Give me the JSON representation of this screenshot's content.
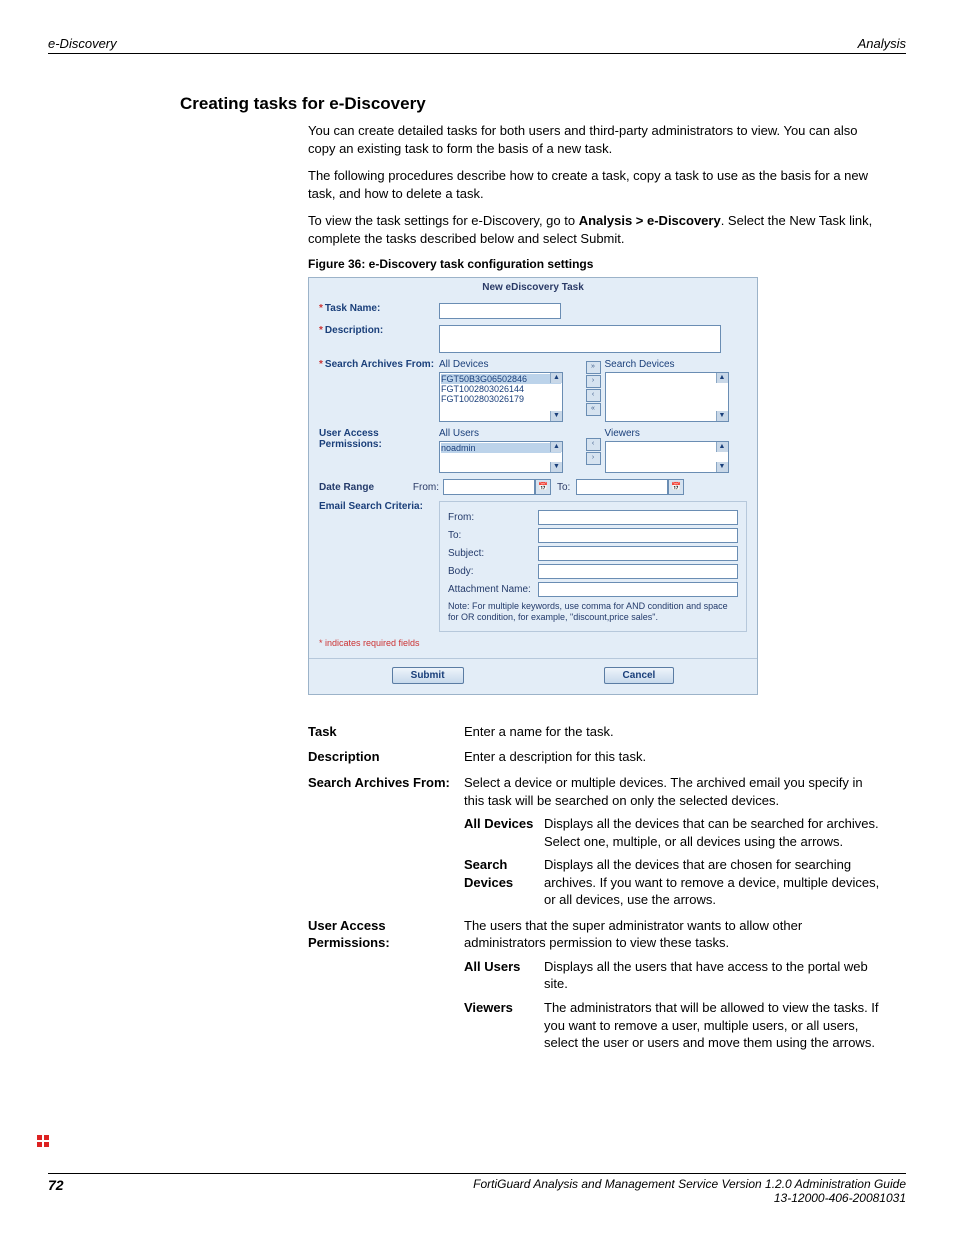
{
  "header": {
    "left": "e-Discovery",
    "right": "Analysis"
  },
  "h2": "Creating tasks for e-Discovery",
  "p1": "You can create detailed tasks for both users and third-party administrators to view. You can also copy an existing task to form the basis of a new task.",
  "p2": "The following procedures describe how to create a task, copy a task to use as the basis for a new task, and how to delete a task.",
  "p3a": "To view the task settings for e-Discovery, go to ",
  "p3b": "Analysis > e-Discovery",
  "p3c": ". Select the New Task link, complete the tasks described below and select Submit.",
  "figcap": "Figure 36: e-Discovery task configuration settings",
  "shot": {
    "title": "New eDiscovery Task",
    "labels": {
      "task_name": "Task Name:",
      "description": "Description:",
      "search_from": "Search Archives From:",
      "all_devices": "All Devices",
      "search_devices": "Search Devices",
      "uap": "User Access Permissions:",
      "all_users": "All Users",
      "viewers": "Viewers",
      "date_range": "Date Range",
      "from": "From:",
      "to": "To:",
      "criteria": "Email Search Criteria:",
      "c_from": "From:",
      "c_to": "To:",
      "c_subject": "Subject:",
      "c_body": "Body:",
      "c_attach": "Attachment Name:",
      "note": "Note: For multiple keywords, use comma for AND condition and space for OR condition, for example, \"discount,price sales\".",
      "req": "* indicates required fields",
      "submit": "Submit",
      "cancel": "Cancel"
    },
    "devices": [
      "FGT50B3G06502846",
      "FGT1002803026144",
      "FGT1002803026179"
    ],
    "users": [
      "noadmin"
    ]
  },
  "def": {
    "task": {
      "t": "Task",
      "d": "Enter a name for the task."
    },
    "desc": {
      "t": "Description",
      "d": "Enter a description for this task."
    },
    "saf": {
      "t": "Search Archives From:",
      "d": "Select a device or multiple devices. The archived email you specify in this task will be searched on only the selected devices.",
      "sub": {
        "ad": {
          "t": "All Devices",
          "d": "Displays all the devices that can be searched for archives. Select one, multiple, or all devices using the arrows."
        },
        "sd": {
          "t": "Search Devices",
          "d": "Displays all the devices that are chosen for searching archives. If you want to remove a device, multiple devices, or all devices, use the arrows."
        }
      }
    },
    "uap": {
      "t": "User Access Permissions:",
      "d": "The users that the super administrator wants to allow other administrators permission to view these tasks.",
      "sub": {
        "au": {
          "t": "All Users",
          "d": "Displays all the users that have access to the portal web site."
        },
        "vw": {
          "t": "Viewers",
          "d": "The administrators that will be allowed to view the tasks. If you want to remove a user, multiple users, or all users, select the user or users and move them using the arrows."
        }
      }
    }
  },
  "footer": {
    "page": "72",
    "line1": "FortiGuard Analysis and Management Service Version 1.2.0 Administration Guide",
    "line2": "13-12000-406-20081031"
  },
  "brand": "FORTINET"
}
